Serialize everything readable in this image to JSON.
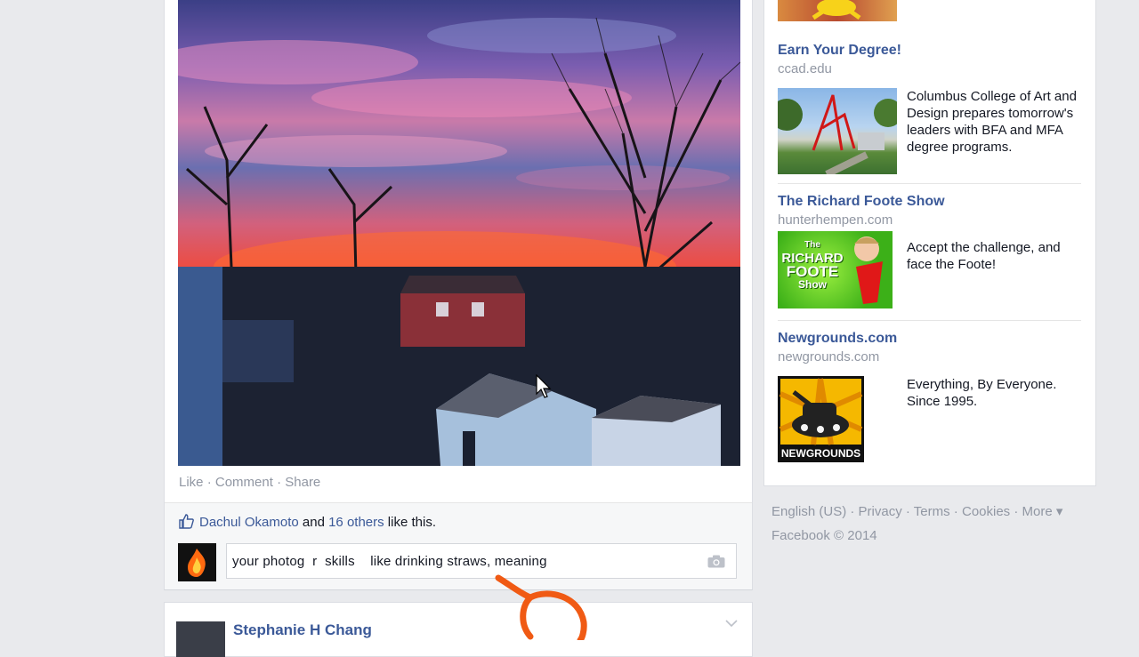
{
  "post": {
    "actions": {
      "like": "Like",
      "comment": "Comment",
      "share": "Share",
      "sep": " · "
    },
    "likes": {
      "name": "Dachul Okamoto",
      "and": " and ",
      "others": "16 others",
      "suffix": " like this."
    },
    "comment_input": {
      "value": "your photog  r  skills    like drinking straws, meaning"
    }
  },
  "next_post": {
    "author": "Stephanie H Chang"
  },
  "ads": [
    {
      "title": "Earn Your Degree!",
      "domain": "ccad.edu",
      "text": "Columbus College of Art and Design prepares tomorrow's leaders with BFA and MFA degree programs."
    },
    {
      "title": "The Richard Foote Show",
      "domain": "hunterhempen.com",
      "text": "Accept the challenge, and face the Foote!",
      "image_text": [
        "The",
        "RICHARD",
        "FOOTE",
        "Show"
      ]
    },
    {
      "title": "Newgrounds.com",
      "domain": "newgrounds.com",
      "text": "Everything, By Everyone. Since 1995.",
      "image_text": "NEWGROUNDS"
    }
  ],
  "footer": {
    "links": [
      "English (US)",
      "Privacy",
      "Terms",
      "Cookies",
      "More ▾"
    ],
    "copyright": "Facebook © 2014"
  },
  "colors": {
    "link": "#3b5998",
    "muted": "#9197a3",
    "background": "#e9eaed",
    "annotation": "#f05a14"
  }
}
